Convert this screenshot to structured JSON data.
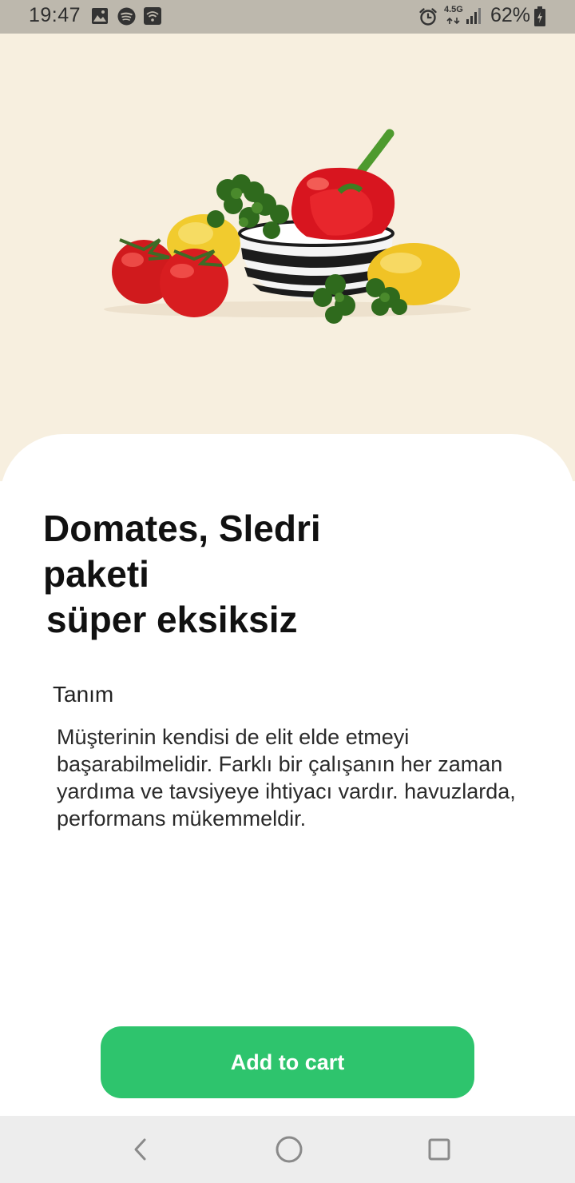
{
  "status_bar": {
    "time": "19:47",
    "network_type": "4.5G",
    "battery_percent": "62%",
    "icons": [
      "gallery-icon",
      "spotify-icon",
      "wifi-hotspot-icon",
      "alarm-icon",
      "signal-icon",
      "battery-charging-icon"
    ]
  },
  "product": {
    "title_lines": [
      "Domates, Sledri",
      "paketi",
      "süper eksiksiz"
    ],
    "description_label": "Tanım",
    "description": "Müşterinin kendisi de elit elde etmeyi başarabilmelidir. Farklı bir çalışanın her zaman yardıma ve tavsiyeye ihtiyacı vardır. havuzlarda, performans mükemmeldir."
  },
  "actions": {
    "add_to_cart_label": "Add to cart"
  },
  "navigation": {
    "buttons": [
      "back-icon",
      "home-icon",
      "recents-icon"
    ]
  },
  "colors": {
    "accent": "#2ec46d",
    "hero_background": "#f7efdf",
    "status_bar": "#bdb8ad"
  }
}
